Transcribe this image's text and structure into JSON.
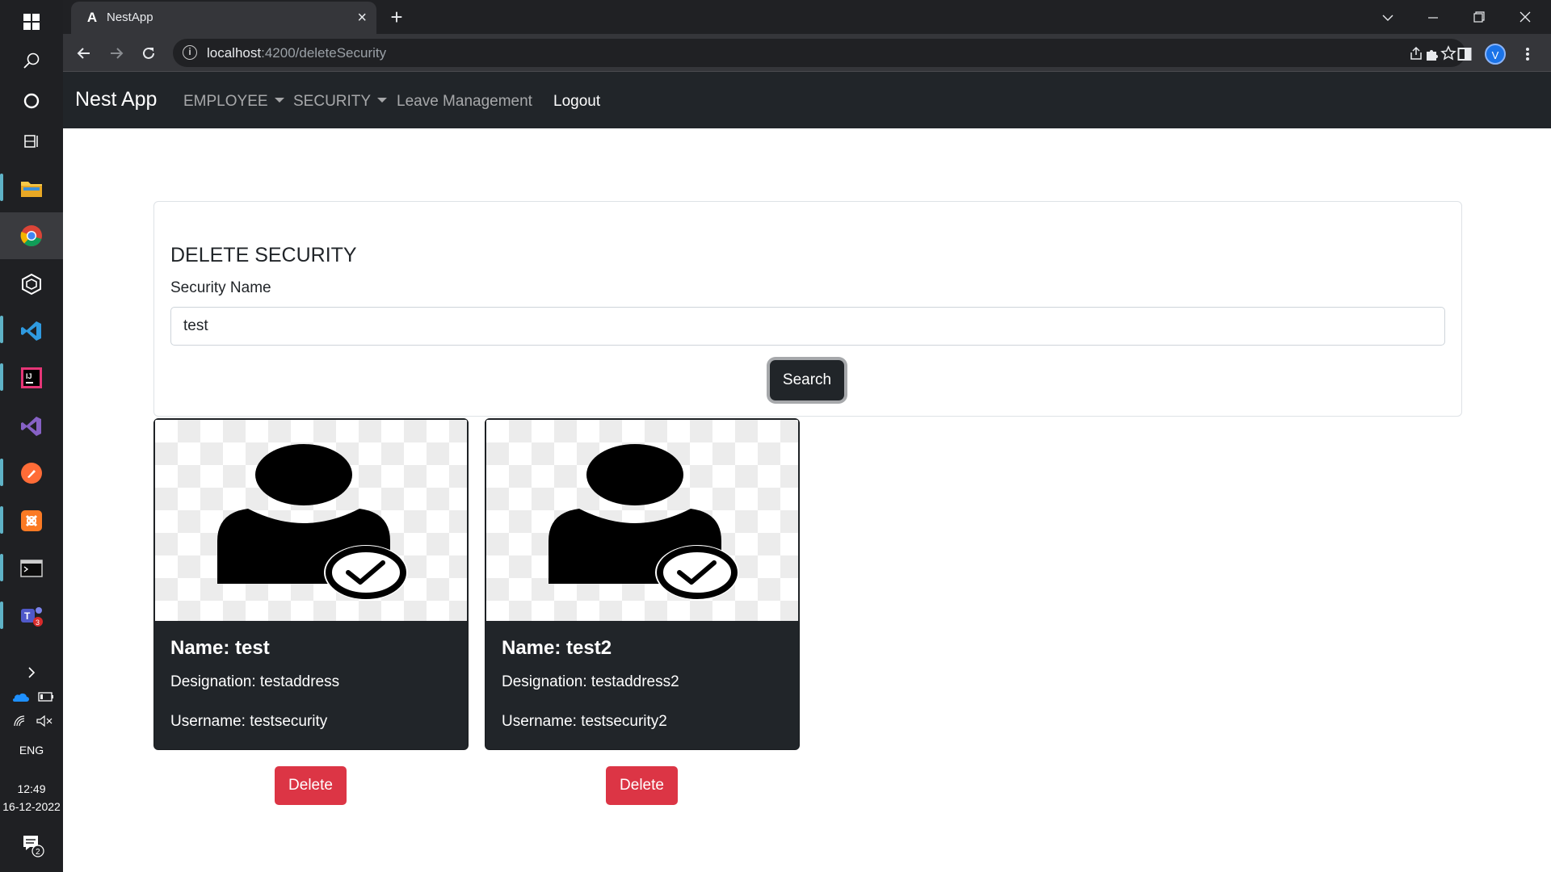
{
  "taskbar": {
    "lang": "ENG",
    "time": "12:49",
    "date": "16-12-2022",
    "notification_count": "2",
    "teams_badge": "3"
  },
  "browser": {
    "tab_title": "NestApp",
    "tab_favicon": "A",
    "url_host": "localhost",
    "url_rest": ":4200/deleteSecurity",
    "profile_initial": "V"
  },
  "navbar": {
    "brand": "Nest App",
    "links": [
      {
        "label": "EMPLOYEE",
        "dropdown": true
      },
      {
        "label": "SECURITY",
        "dropdown": true
      },
      {
        "label": "Leave Management",
        "dropdown": false
      },
      {
        "label": "Logout",
        "dropdown": false
      }
    ]
  },
  "search": {
    "heading": "DELETE SECURITY",
    "label": "Security Name",
    "value": "test",
    "button_label": "Search"
  },
  "results": [
    {
      "name": "Name: test",
      "designation": "Designation: testaddress",
      "username": "Username: testsecurity",
      "delete_label": "Delete"
    },
    {
      "name": "Name: test2",
      "designation": "Designation: testaddress2",
      "username": "Username: testsecurity2",
      "delete_label": "Delete"
    }
  ],
  "colors": {
    "navbar_bg": "#212529",
    "delete_red": "#dc3545",
    "card_bg": "#212529"
  }
}
